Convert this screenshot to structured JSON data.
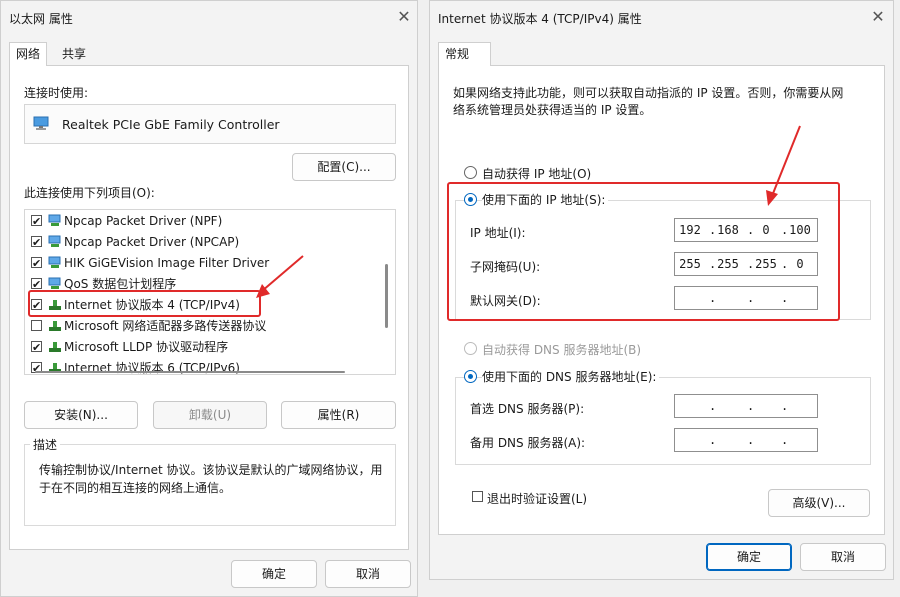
{
  "left": {
    "title": "以太网 属性",
    "tabs": [
      "网络",
      "共享"
    ],
    "connect_using_label": "连接时使用:",
    "adapter": "Realtek PCIe GbE Family Controller",
    "configure_btn": "配置(C)...",
    "items_label": "此连接使用下列项目(O):",
    "items": [
      {
        "label": "Npcap Packet Driver (NPF)",
        "checked": true
      },
      {
        "label": "Npcap Packet Driver (NPCAP)",
        "checked": true
      },
      {
        "label": "HIK GiGEVision Image Filter Driver",
        "checked": true
      },
      {
        "label": "QoS 数据包计划程序",
        "checked": true
      },
      {
        "label": "Internet 协议版本 4 (TCP/IPv4)",
        "checked": true
      },
      {
        "label": "Microsoft 网络适配器多路传送器协议",
        "checked": false
      },
      {
        "label": "Microsoft LLDP 协议驱动程序",
        "checked": true
      },
      {
        "label": "Internet 协议版本 6 (TCP/IPv6)",
        "checked": true
      }
    ],
    "install_btn": "安装(N)...",
    "uninstall_btn": "卸载(U)",
    "properties_btn": "属性(R)",
    "desc_title": "描述",
    "desc_text_1": "传输控制协议/Internet 协议。该协议是默认的广域网络协议，用",
    "desc_text_2": "于在不同的相互连接的网络上通信。",
    "ok_btn": "确定",
    "cancel_btn": "取消"
  },
  "right": {
    "title": "Internet 协议版本 4 (TCP/IPv4) 属性",
    "tab": "常规",
    "intro_1": "如果网络支持此功能，则可以获取自动指派的 IP 设置。否则，你需要从网",
    "intro_2": "络系统管理员处获得适当的 IP 设置。",
    "auto_ip": "自动获得 IP 地址(O)",
    "use_ip": "使用下面的 IP 地址(S):",
    "ip_label": "IP 地址(I):",
    "mask_label": "子网掩码(U):",
    "gateway_label": "默认网关(D):",
    "ip": [
      "192",
      "168",
      "0",
      "100"
    ],
    "mask": [
      "255",
      "255",
      "255",
      "0"
    ],
    "auto_dns": "自动获得 DNS 服务器地址(B)",
    "use_dns": "使用下面的 DNS 服务器地址(E):",
    "pref_dns_label": "首选 DNS 服务器(P):",
    "alt_dns_label": "备用 DNS 服务器(A):",
    "validate": "退出时验证设置(L)",
    "advanced_btn": "高级(V)...",
    "ok_btn": "确定",
    "cancel_btn": "取消"
  },
  "colors": {
    "accent": "#0067c0",
    "highlight": "#e02a2a"
  }
}
